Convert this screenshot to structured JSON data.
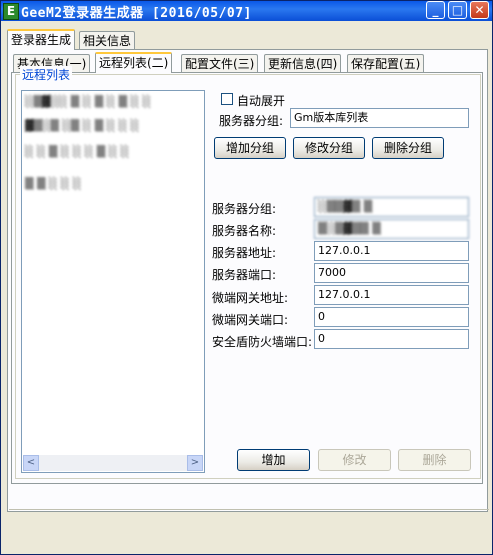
{
  "window": {
    "title": "GeeM2登录器生成器 [2016/05/07]",
    "icon_letter": "E",
    "min_glyph": "_",
    "max_glyph": "□",
    "close_glyph": "✕"
  },
  "top_tabs": [
    {
      "label": "登录器生成",
      "active": true
    },
    {
      "label": "相关信息",
      "active": false
    }
  ],
  "sub_tabs": [
    {
      "label": "基本信息(一)",
      "active": false
    },
    {
      "label": "远程列表(二)",
      "active": true
    },
    {
      "label": "配置文件(三)",
      "active": false
    },
    {
      "label": "更新信息(四)",
      "active": false
    },
    {
      "label": "保存配置(五)",
      "active": false
    }
  ],
  "group": {
    "title": "远程列表"
  },
  "list": {
    "items": [
      "░▒▓░░ ▒ ░ ▒ ░ ▒ ░ ░",
      "▓▒░▒ ░▒ ░ ▒ ░ ░ ░",
      "░ ░ ▒ ░ ░ ░ ▒ ░ ░",
      "▒ ▒ ░ ░ ░"
    ],
    "scroll_left": "<",
    "scroll_right": ">"
  },
  "auto_expand": {
    "label": "自动展开",
    "checked": false
  },
  "server_group_top": {
    "label": "服务器分组:",
    "value": "Gm版本库列表"
  },
  "group_buttons": {
    "add": "增加分组",
    "edit": "修改分组",
    "delete": "删除分组"
  },
  "fields": [
    {
      "label": "服务器分组:",
      "value": "░▒▒▓▒ ▒",
      "blurred": true
    },
    {
      "label": "服务器名称:",
      "value": "▒░▒▓▒▒ ▒",
      "blurred": true
    },
    {
      "label": "服务器地址:",
      "value": "127.0.0.1",
      "blurred": false
    },
    {
      "label": "服务器端口:",
      "value": "7000",
      "blurred": false
    },
    {
      "label": "微端网关地址:",
      "value": "127.0.0.1",
      "blurred": false
    },
    {
      "label": "微端网关端口:",
      "value": "0",
      "blurred": false
    },
    {
      "label": "安全盾防火墙端口:",
      "value": "0",
      "blurred": false
    }
  ],
  "action_buttons": {
    "add": "增加",
    "edit": "修改",
    "delete": "删除"
  }
}
